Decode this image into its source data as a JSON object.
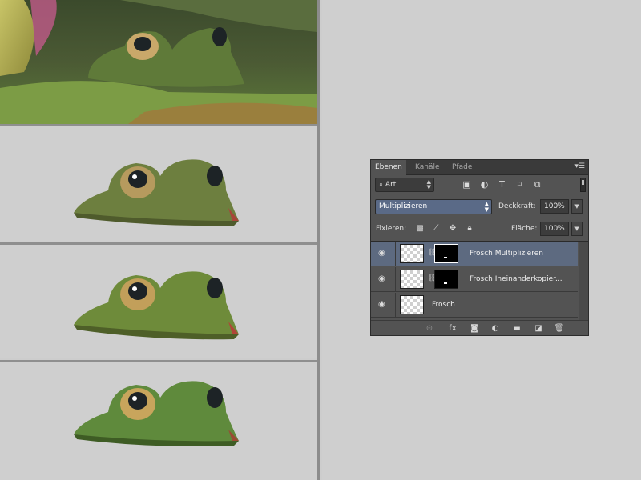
{
  "layers_panel": {
    "tabs": [
      {
        "label": "Ebenen",
        "active": true
      },
      {
        "label": "Kanäle",
        "active": false
      },
      {
        "label": "Pfade",
        "active": false
      }
    ],
    "filter": {
      "value": "Art"
    },
    "filter_icons": [
      "image-filter-icon",
      "adjustment-filter-icon",
      "type-filter-icon",
      "shape-filter-icon",
      "smart-object-filter-icon"
    ],
    "blend_mode": "Multiplizieren",
    "opacity": {
      "label": "Deckkraft:",
      "value": "100%"
    },
    "lock": {
      "label": "Fixieren:"
    },
    "fill": {
      "label": "Fläche:",
      "value": "100%"
    },
    "layers": [
      {
        "name": "Frosch Multiplizieren",
        "selected": true,
        "has_mask": true
      },
      {
        "name": "Frosch Ineinanderkopier...",
        "selected": false,
        "has_mask": true
      },
      {
        "name": "Frosch",
        "selected": false,
        "has_mask": false
      }
    ],
    "footer_icons": [
      "link-layers-icon",
      "fx-icon",
      "add-mask-icon",
      "adjustment-layer-icon",
      "new-group-icon",
      "new-layer-icon",
      "trash-icon"
    ],
    "colors": {
      "panel": "#535353",
      "tab_bar": "#3a3a3a",
      "selected_row": "#5d6a80",
      "blend_select": "#5a6a87"
    }
  }
}
